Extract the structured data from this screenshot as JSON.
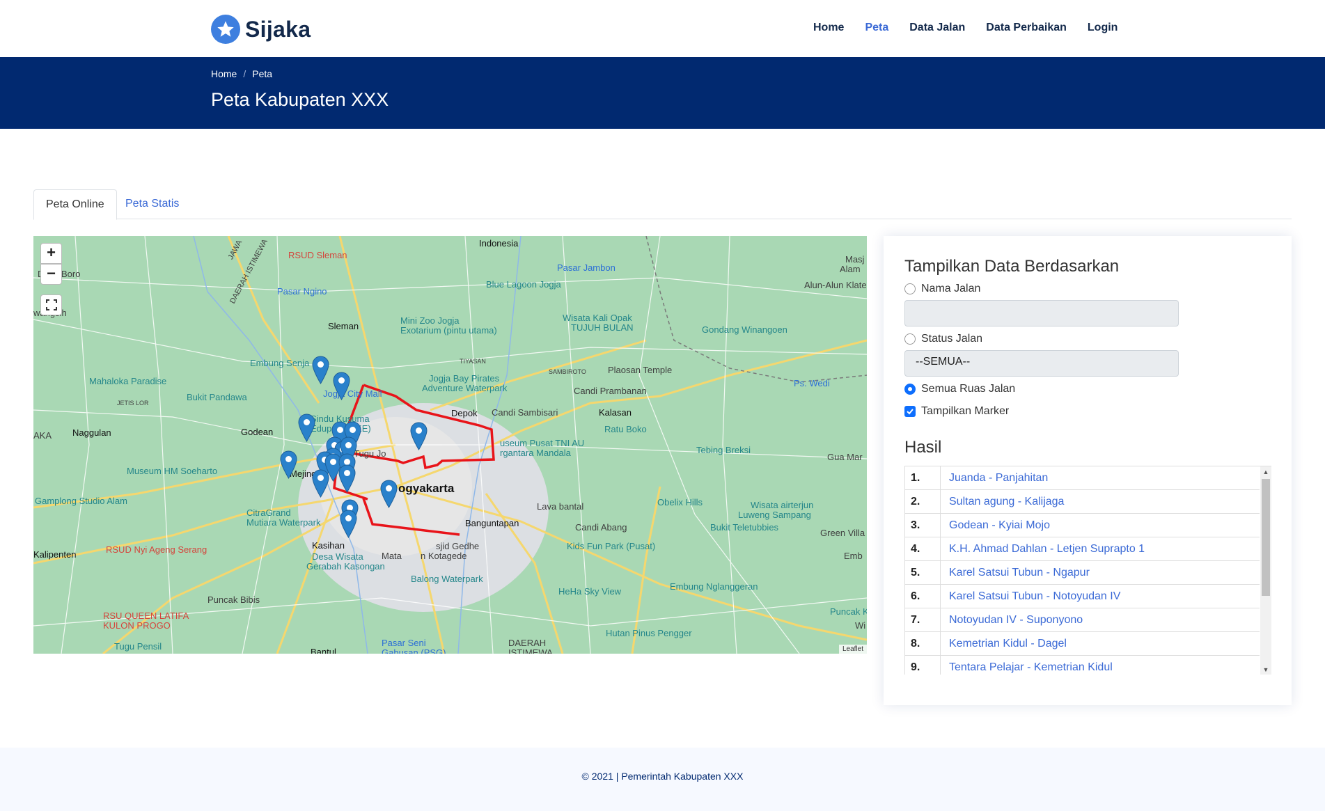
{
  "brand": {
    "name": "Sijaka"
  },
  "nav": {
    "items": [
      "Home",
      "Peta",
      "Data Jalan",
      "Data Perbaikan",
      "Login"
    ],
    "active": "Peta"
  },
  "breadcrumb": {
    "home": "Home",
    "current": "Peta"
  },
  "page": {
    "title": "Peta Kabupaten XXX"
  },
  "tabs": {
    "online": "Peta Online",
    "static": "Peta Statis"
  },
  "map": {
    "zoom_in": "+",
    "zoom_out": "−",
    "attribution": "Leaflet",
    "labels": {
      "l_universitas": "Indonesia",
      "l_rsud_sleman": "RSUD Sleman",
      "l_pasar_jambon": "Pasar Jambon",
      "l_deso_boro": "Deso Boro",
      "l_pasar_ngino": "Pasar Ngino",
      "l_blue_lagoon": "Blue Lagoon Jogja",
      "l_alun_alun": "Alun-Alun Klate",
      "l_wangsih": "wangsih",
      "l_sleman": "Sleman",
      "l_mini_zoo": "Mini Zoo Jogja",
      "l_exotarium": "Exotarium (pintu utama)",
      "l_kali_opak": "Wisata Kali Opak",
      "l_tujuh_bulan": "TUJUH BULAN",
      "l_gondang": "Gondang Winangoen",
      "l_embung_senja": "Embung Senja",
      "l_pirates": "Jogja Bay Pirates",
      "l_adventure": "Adventure Waterpark",
      "l_sambiroto": "SAMBIROTO",
      "l_plaosan": "Plaosan Temple",
      "l_mahaloka": "Mahaloka Paradise",
      "l_ps_wedi": "Ps. Wedi",
      "l_tiyasan": "TIYASAN",
      "l_bukit_pandawa": "Bukit Pandawa",
      "l_city_mall": "Jogja City Mall",
      "l_candi_prambanan": "Candi Prambanan",
      "l_jetis_lor": "JETIS LOR",
      "l_depok": "Depok",
      "l_candi_sambisari": "Candi Sambisari",
      "l_kalasan": "Kalasan",
      "l_sindu": "Sindu Kusuma",
      "l_edupark": "Edupark (SKE)",
      "l_ratu_boko": "Ratu Boko",
      "l_aka": "AKA",
      "l_nagulan": "Naggulan",
      "l_godean": "Godean",
      "l_tugu": "Tugu Jo",
      "l_museum_tni": "useum Pusat TNI AU",
      "l_dirgantara": "rgantara Mandala",
      "l_tebing": "Tebing Breksi",
      "l_gua_mar": "Gua Mar",
      "l_museum_hm": "Museum HM Soeharto",
      "l_mejing": "Mejing L",
      "l_yogyakarta": "ogyakarta",
      "l_gamplong": "Gamplong Studio Alam",
      "l_lava_bantal": "Lava bantal",
      "l_obelix": "Obelix Hills",
      "l_airterjun": "Wisata airterjun",
      "l_luweng": "Luweng Sampang",
      "l_citragrand": "CitraGrand",
      "l_mutiara": "Mutiara Waterpark",
      "l_banguntapan": "Banguntapan",
      "l_candi_abang": "Candi Abang",
      "l_bukit_teletubbies": "Bukit Teletubbies",
      "l_green_villa": "Green Villa",
      "l_kalipenten": "Kalipenten",
      "l_rsud_nyi": "RSUD Nyi Ageng Serang",
      "l_kasihan": "Kasihan",
      "l_desa_wisata": "Desa Wisata",
      "l_gerabah": "Gerabah Kasongan",
      "l_masjid": "sjid Gedhe",
      "l_mataram": "Mata",
      "l_kotagede": "n Kotagede",
      "l_kids_fun": "Kids Fun Park (Pusat)",
      "l_emb": "Emb",
      "l_balong": "Balong Waterpark",
      "l_hehe": "HeHa Sky View",
      "l_embung_ng": "Embung Nglanggeran",
      "l_puncak_bibis": "Puncak Bibis",
      "l_rsu_queen": "RSU QUEEN LATIFA",
      "l_kulon_progo": "KULON PROGO",
      "l_puncak_k": "Puncak K",
      "l_wi": "Wi",
      "l_hutan_pinus": "Hutan Pinus Pengger",
      "l_tugu_pensil": "Tugu Pensil",
      "l_bantul": "Bantul",
      "l_pasar_seni": "Pasar Seni",
      "l_gabusan": "Gabusan (PSG)",
      "l_daerah": "DAERAH",
      "l_istimewa": "ISTIMEWA",
      "l_jawa": "JAWA",
      "l_daerah_istimewa_road": "DAERAH ISTIMEWA",
      "l_masj": "Masj",
      "l_alam": "Alam"
    }
  },
  "filter": {
    "title": "Tampilkan Data Berdasarkan",
    "opt_nama": "Nama Jalan",
    "nama_value": "",
    "opt_status": "Status Jalan",
    "status_value": "--SEMUA--",
    "opt_semua": "Semua Ruas Jalan",
    "opt_marker": "Tampilkan Marker",
    "selected": "Semua Ruas Jalan",
    "marker_checked": true
  },
  "results": {
    "title": "Hasil",
    "items": [
      {
        "num": "1.",
        "name": "Juanda - Panjahitan"
      },
      {
        "num": "2.",
        "name": "Sultan agung - Kalijaga"
      },
      {
        "num": "3.",
        "name": "Godean - Kyiai Mojo"
      },
      {
        "num": "4.",
        "name": "K.H. Ahmad Dahlan - Letjen Suprapto 1"
      },
      {
        "num": "5.",
        "name": "Karel Satsui Tubun - Ngapur"
      },
      {
        "num": "6.",
        "name": "Karel Satsui Tubun - Notoyudan IV"
      },
      {
        "num": "7.",
        "name": "Notoyudan IV - Suponyono"
      },
      {
        "num": "8.",
        "name": "Kemetrian Kidul - Dagel"
      },
      {
        "num": "9.",
        "name": "Tentara Pelajar - Kemetrian Kidul"
      }
    ]
  },
  "footer": {
    "text": "© 2021 | Pemerintah Kabupaten XXX"
  },
  "colors": {
    "primary": "#012970",
    "link": "#3b6ad6",
    "route": "#e8141a",
    "marker": "#2a81cb",
    "map_bg": "#a9d8b4"
  }
}
